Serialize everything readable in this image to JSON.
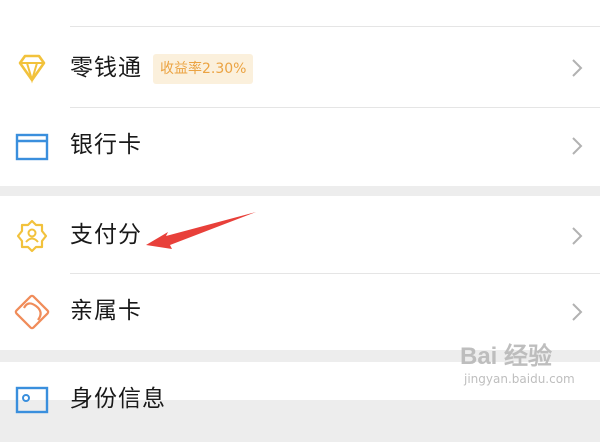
{
  "menu": {
    "items": [
      {
        "label": "零钱通",
        "icon": "diamond-icon"
      },
      {
        "label": "银行卡",
        "icon": "card-icon"
      },
      {
        "label": "支付分",
        "icon": "badge-person-icon"
      },
      {
        "label": "亲属卡",
        "icon": "heart-card-icon"
      },
      {
        "label": "身份信息",
        "icon": "id-card-icon"
      }
    ],
    "badge": "收益率2.30%"
  },
  "watermark": {
    "top": "Bai 经验",
    "bottom": "jingyan.baidu.com"
  },
  "colors": {
    "accent_yellow": "#f2c23c",
    "card_blue": "#3a8fdd",
    "heart_orange": "#f08c5a",
    "annotation_red": "#e8403a",
    "separator_gray": "#ededed"
  }
}
